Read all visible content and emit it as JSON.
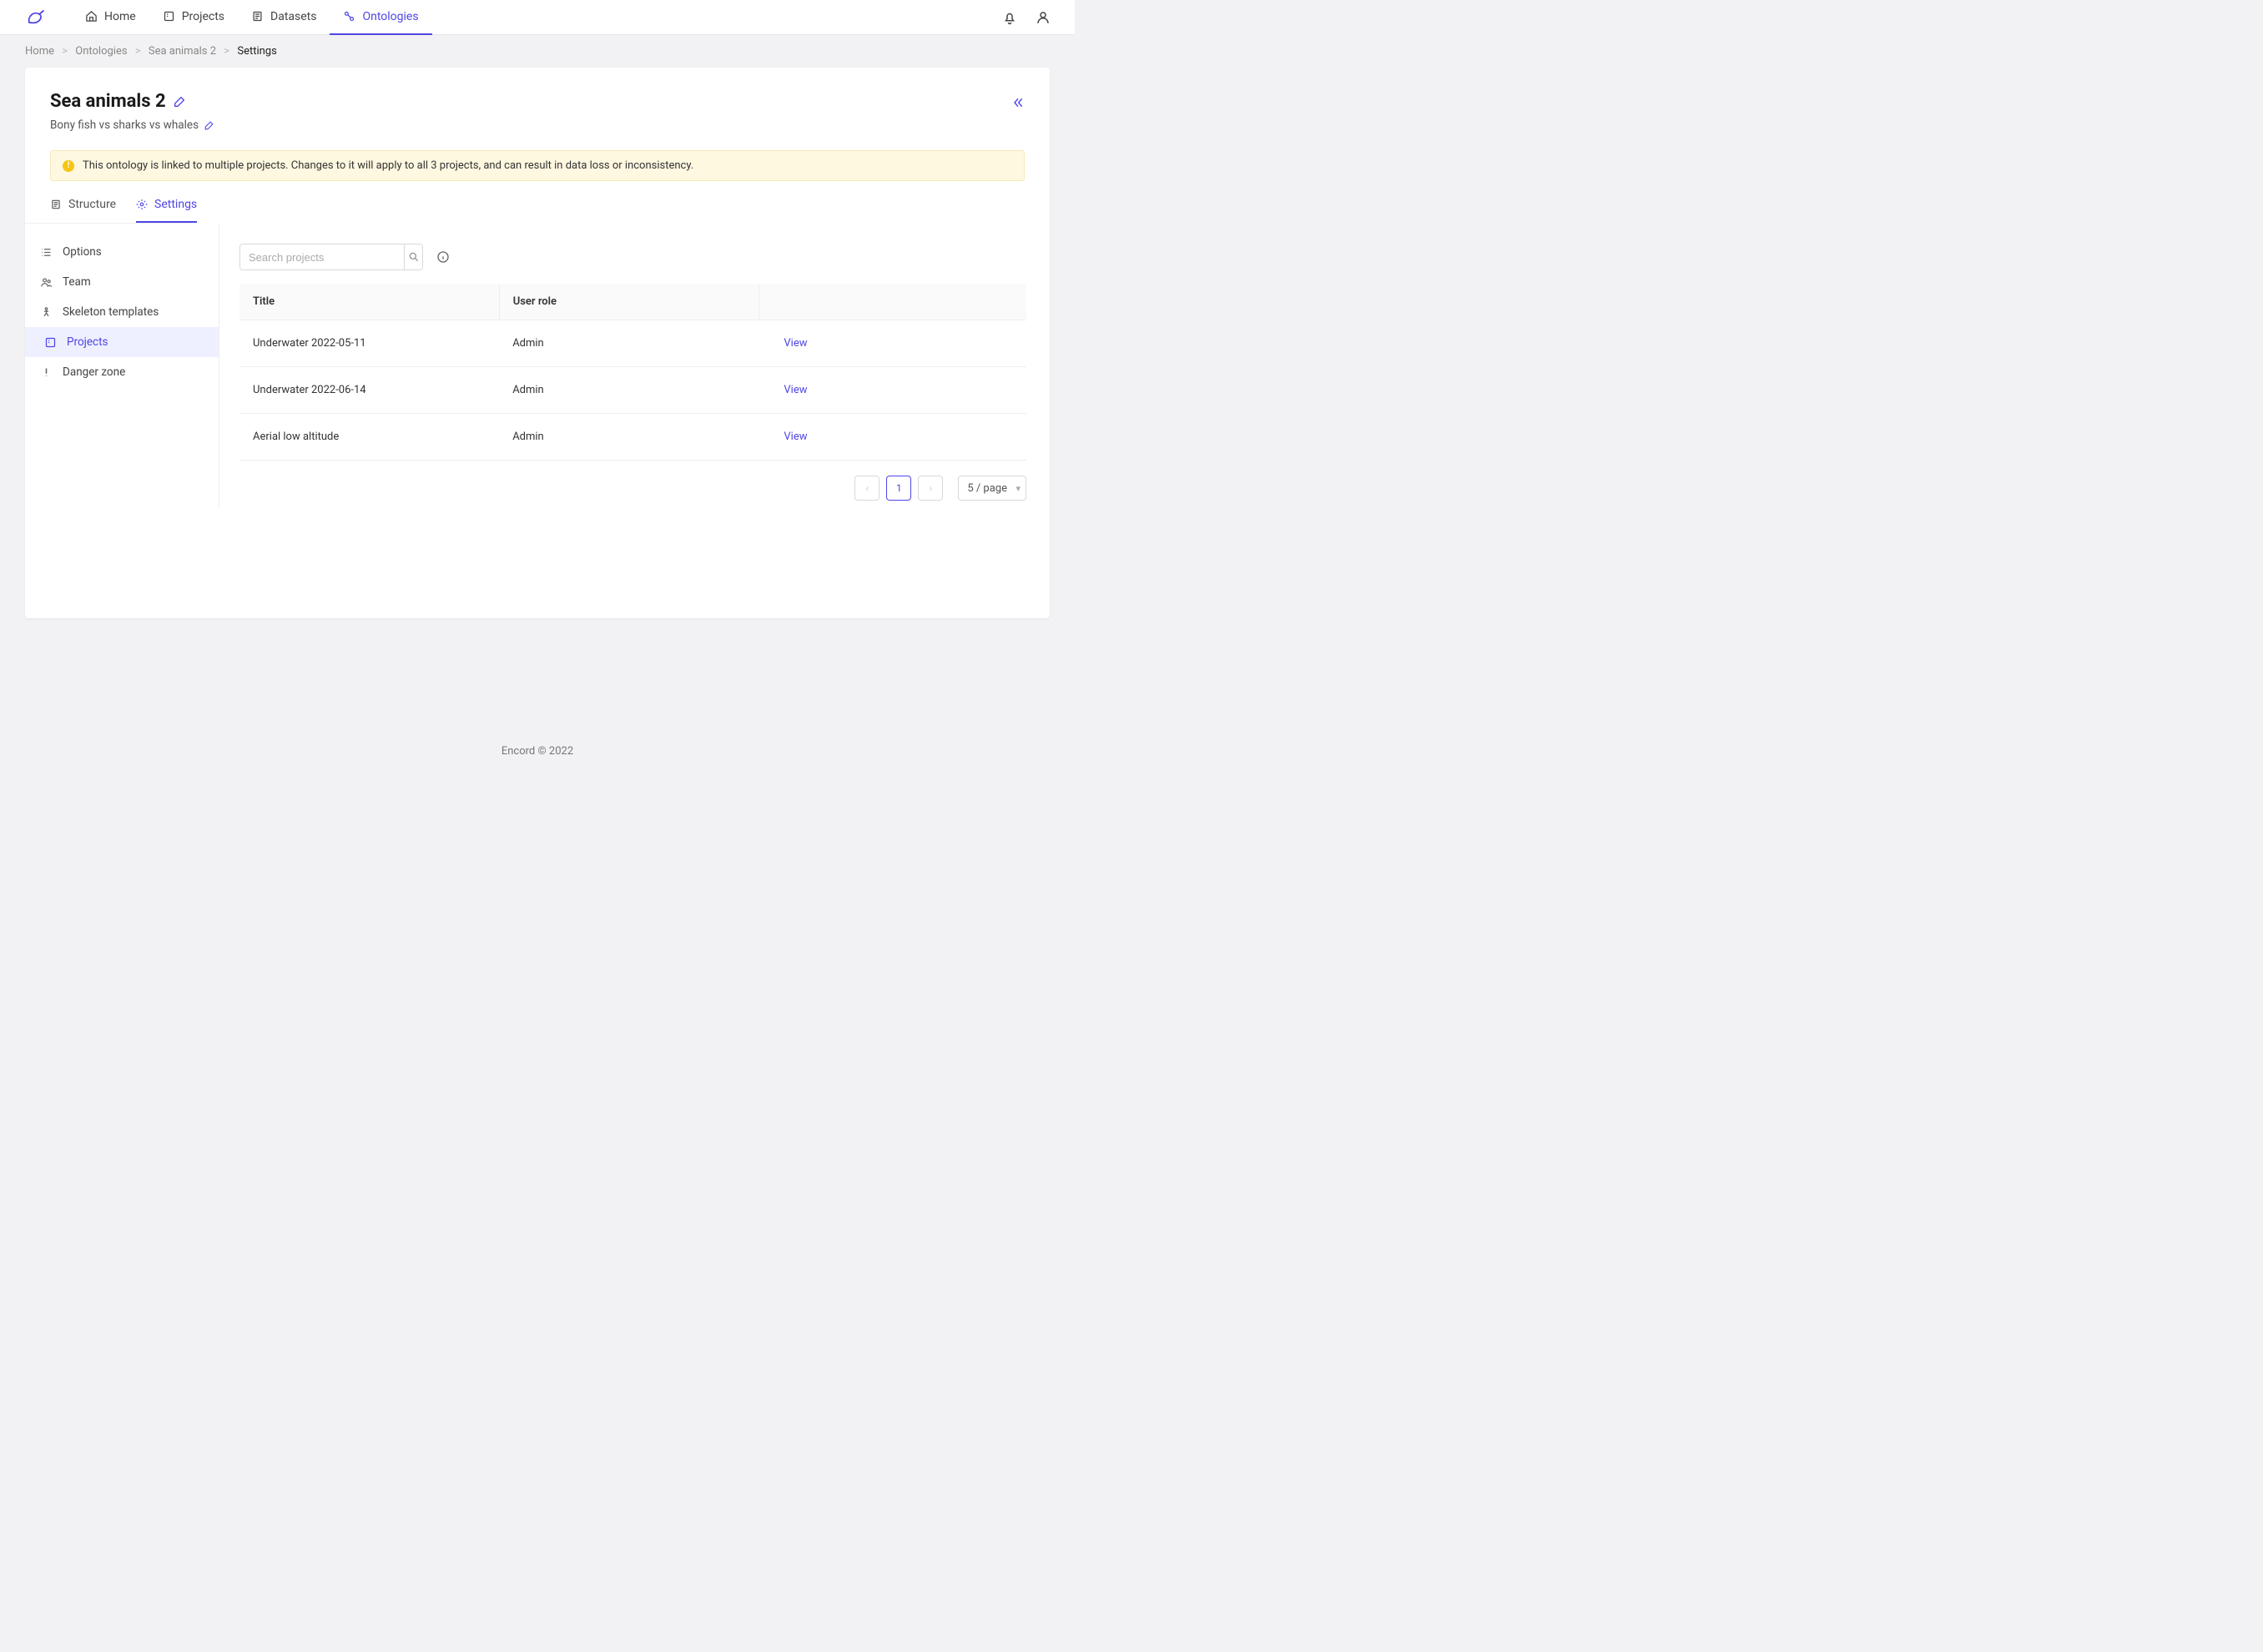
{
  "nav": {
    "items": [
      {
        "label": "Home"
      },
      {
        "label": "Projects"
      },
      {
        "label": "Datasets"
      },
      {
        "label": "Ontologies"
      }
    ]
  },
  "breadcrumb": {
    "items": [
      "Home",
      "Ontologies",
      "Sea animals 2"
    ],
    "current": "Settings"
  },
  "page": {
    "title": "Sea animals 2",
    "subtitle": "Bony fish vs sharks vs whales"
  },
  "warning": "This ontology is linked to multiple projects. Changes to it will apply to all 3 projects, and can result in data loss or inconsistency.",
  "tabs": [
    {
      "label": "Structure"
    },
    {
      "label": "Settings"
    }
  ],
  "sidebar": {
    "items": [
      {
        "label": "Options"
      },
      {
        "label": "Team"
      },
      {
        "label": "Skeleton templates"
      },
      {
        "label": "Projects"
      },
      {
        "label": "Danger zone"
      }
    ]
  },
  "search": {
    "placeholder": "Search projects",
    "value": ""
  },
  "table": {
    "columns": [
      "Title",
      "User role",
      ""
    ],
    "rows": [
      {
        "title": "Underwater 2022-05-11",
        "role": "Admin",
        "action": "View"
      },
      {
        "title": "Underwater 2022-06-14",
        "role": "Admin",
        "action": "View"
      },
      {
        "title": "Aerial low altitude",
        "role": "Admin",
        "action": "View"
      }
    ]
  },
  "pagination": {
    "current": "1",
    "page_size": "5 / page"
  },
  "footer": "Encord © 2022"
}
